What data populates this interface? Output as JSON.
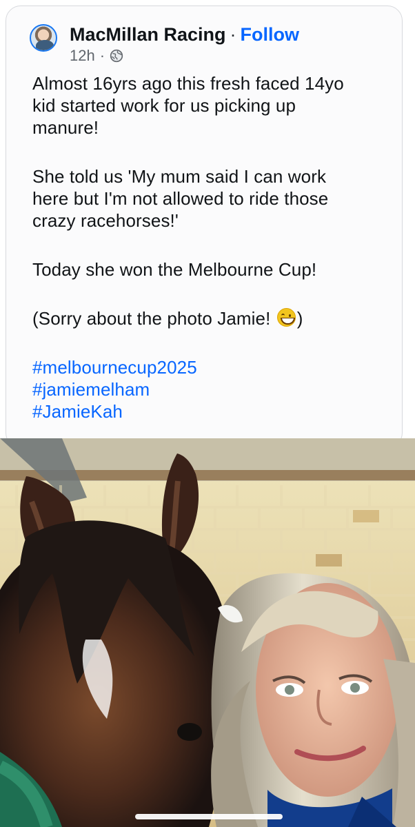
{
  "post": {
    "author": "MacMillan Racing",
    "separator": "·",
    "follow_label": "Follow",
    "time": "12h",
    "time_separator": "·",
    "privacy_icon": "globe-icon",
    "lines": {
      "p1_1": "Almost 16yrs ago this fresh faced 14yo",
      "p1_2": "kid started work for us picking up",
      "p1_3": "manure!",
      "p2_1": "She told us 'My mum said I can work",
      "p2_2": "here but I'm not allowed to ride those",
      "p2_3": "crazy racehorses!'",
      "p3_1": "Today she won the Melbourne Cup!",
      "p4_before_emoji": "(Sorry about the photo Jamie! ",
      "p4_after_emoji": ")"
    },
    "emoji": "grinning-face-icon",
    "hashtags": [
      "#melbournecup2025",
      "#jamiemelham",
      "#JamieKah"
    ]
  },
  "media": {
    "type": "photo",
    "subject_icons": [
      "horse-icon",
      "person-icon"
    ],
    "colors": {
      "brick": "#d9c58d",
      "horse": "#5a3320",
      "mane": "#1f1714",
      "hair": "#c7c0aa",
      "face": "#e5b79c",
      "uniform": "#123d8c"
    }
  },
  "colors": {
    "accent": "#0866ff",
    "text": "#111417",
    "muted": "#60666d",
    "card_border": "#d7d9dd"
  }
}
